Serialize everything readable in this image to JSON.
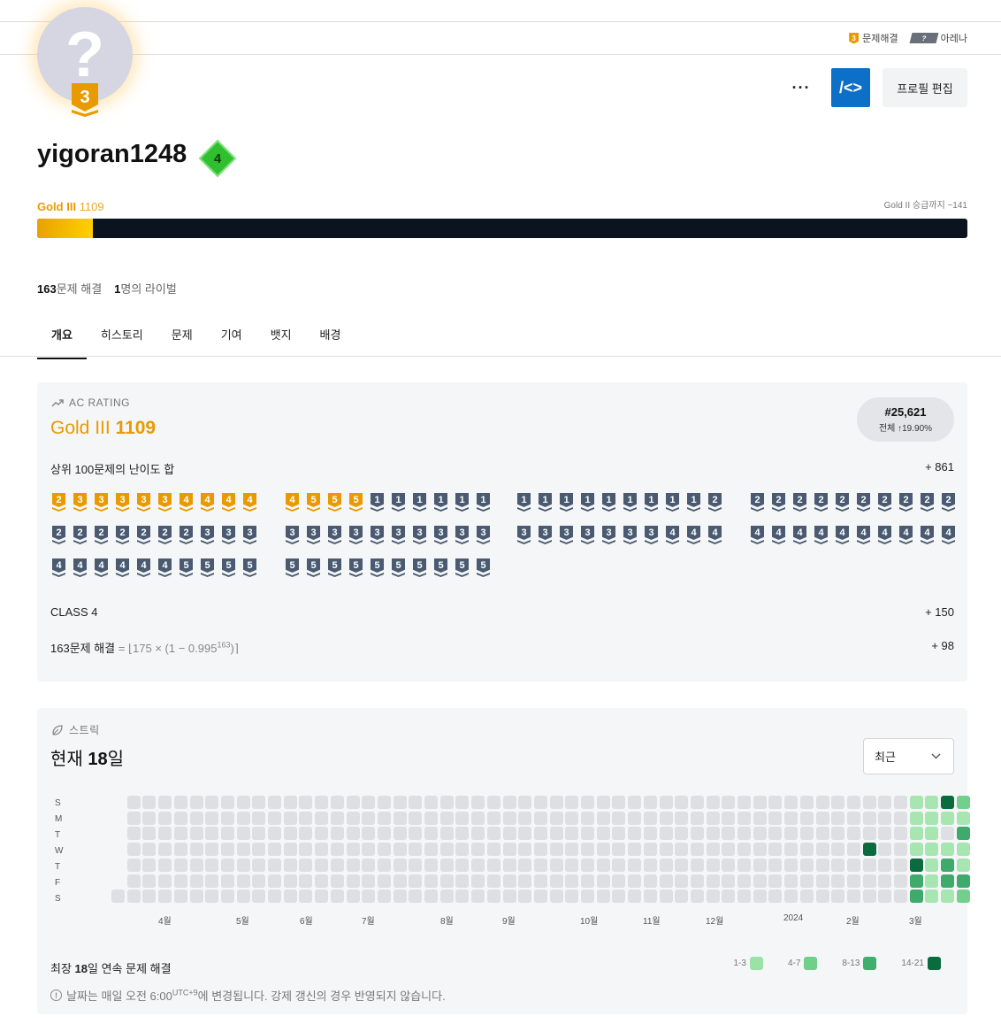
{
  "topbar": {
    "solved_badge": "3",
    "solved_label": "문제해결",
    "arena_badge": "?",
    "arena_label": "아레나"
  },
  "profile": {
    "avatar_glyph": "?",
    "avatar_tier": "3",
    "username": "yigoran1248",
    "class_level": "4",
    "more_label": "···",
    "code_label": "/<>",
    "edit_label": "프로필 편집"
  },
  "tier": {
    "name": "Gold III",
    "rating": "1109",
    "next": "Gold II 승급까지 −141",
    "progress_fraction": 0.06
  },
  "stats": {
    "solved_count": "163",
    "solved_label": "문제 해결",
    "rival_count": "1",
    "rival_label": "명의 라이벌"
  },
  "tabs": [
    "개요",
    "히스토리",
    "문제",
    "기여",
    "뱃지",
    "배경"
  ],
  "ac_rating": {
    "section_label": "AC RATING",
    "tier_name": "Gold III",
    "rating": "1109",
    "rank": "#25,621",
    "rank_percent": "전체 ↑19.90%",
    "top100_label": "상위 100문제의 난이도 합",
    "top100_value": "+ 861",
    "class_label": "CLASS 4",
    "class_value": "+ 150",
    "solved_formula_a": "163문제 해결",
    "solved_formula_b": "= ⌊175 × (1 − 0.995",
    "solved_formula_exp": "163",
    "solved_formula_c": ")⌉",
    "solved_value": "+ 98",
    "tier_rows": [
      [
        [
          "g2",
          "g3",
          "g3",
          "g3",
          "g3",
          "g3",
          "g4",
          "g4",
          "g4",
          "g4"
        ],
        [
          "g4",
          "g5",
          "g5",
          "g5",
          "s1",
          "s1",
          "s1",
          "s1",
          "s1",
          "s1"
        ],
        [
          "s1",
          "s1",
          "s1",
          "s1",
          "s1",
          "s1",
          "s1",
          "s1",
          "s1",
          "s2"
        ],
        [
          "s2",
          "s2",
          "s2",
          "s2",
          "s2",
          "s2",
          "s2",
          "s2",
          "s2",
          "s2"
        ]
      ],
      [
        [
          "s2",
          "s2",
          "s2",
          "s2",
          "s2",
          "s2",
          "s2",
          "s3",
          "s3",
          "s3"
        ],
        [
          "s3",
          "s3",
          "s3",
          "s3",
          "s3",
          "s3",
          "s3",
          "s3",
          "s3",
          "s3"
        ],
        [
          "s3",
          "s3",
          "s3",
          "s3",
          "s3",
          "s3",
          "s3",
          "s4",
          "s4",
          "s4"
        ],
        [
          "s4",
          "s4",
          "s4",
          "s4",
          "s4",
          "s4",
          "s4",
          "s4",
          "s4",
          "s4"
        ]
      ],
      [
        [
          "s4",
          "s4",
          "s4",
          "s4",
          "s4",
          "s4",
          "s5",
          "s5",
          "s5",
          "s5"
        ],
        [
          "s5",
          "s5",
          "s5",
          "s5",
          "s5",
          "s5",
          "s5",
          "s5",
          "s5",
          "s5"
        ]
      ]
    ]
  },
  "streak": {
    "section_label": "스트릭",
    "current_prefix": "현재 ",
    "current_days": "18",
    "current_suffix": "일",
    "select_value": "최근",
    "day_labels": [
      "S",
      "M",
      "T",
      "W",
      "T",
      "F",
      "S"
    ],
    "month_labels": [
      "4월",
      "5월",
      "6월",
      "7월",
      "8월",
      "9월",
      "10월",
      "11월",
      "12월",
      "2024",
      "2월",
      "3월"
    ],
    "longest_prefix": "최장 ",
    "longest_days": "18",
    "longest_suffix": "일 연속 문제 해결",
    "legend": [
      {
        "label": "1-3",
        "color": "#9be2a8"
      },
      {
        "label": "4-7",
        "color": "#6fd08a"
      },
      {
        "label": "8-13",
        "color": "#3fb06c"
      },
      {
        "label": "14-21",
        "color": "#0a6b3f"
      }
    ],
    "note_a": "날짜는 매일 오전 6:00",
    "note_sup": "UTC+9",
    "note_b": "에 변경됩니다. 강제 갱신의 경우 반영되지 않습니다.",
    "empty_color": "#dddfe2",
    "level_colors": [
      "#dddfe2",
      "#a7e5b1",
      "#72cf8c",
      "#3faa6b",
      "#0a6b3f"
    ],
    "activity": [
      [
        51,
        0,
        1
      ],
      [
        51,
        1,
        1
      ],
      [
        51,
        2,
        1
      ],
      [
        51,
        3,
        1
      ],
      [
        51,
        4,
        4
      ],
      [
        51,
        5,
        3
      ],
      [
        51,
        6,
        3
      ],
      [
        52,
        0,
        1
      ],
      [
        52,
        1,
        1
      ],
      [
        52,
        2,
        1
      ],
      [
        52,
        3,
        1
      ],
      [
        52,
        4,
        1
      ],
      [
        52,
        5,
        1
      ],
      [
        52,
        6,
        1
      ],
      [
        53,
        0,
        4
      ],
      [
        53,
        1,
        1
      ],
      [
        53,
        2,
        0
      ],
      [
        53,
        3,
        1
      ],
      [
        53,
        4,
        3
      ],
      [
        53,
        5,
        3
      ],
      [
        53,
        6,
        1
      ],
      [
        54,
        0,
        2
      ],
      [
        54,
        1,
        1
      ],
      [
        54,
        2,
        3
      ],
      [
        54,
        3,
        1
      ],
      [
        54,
        4,
        1
      ],
      [
        54,
        5,
        3
      ],
      [
        54,
        6,
        2
      ],
      [
        48,
        3,
        4
      ]
    ]
  }
}
